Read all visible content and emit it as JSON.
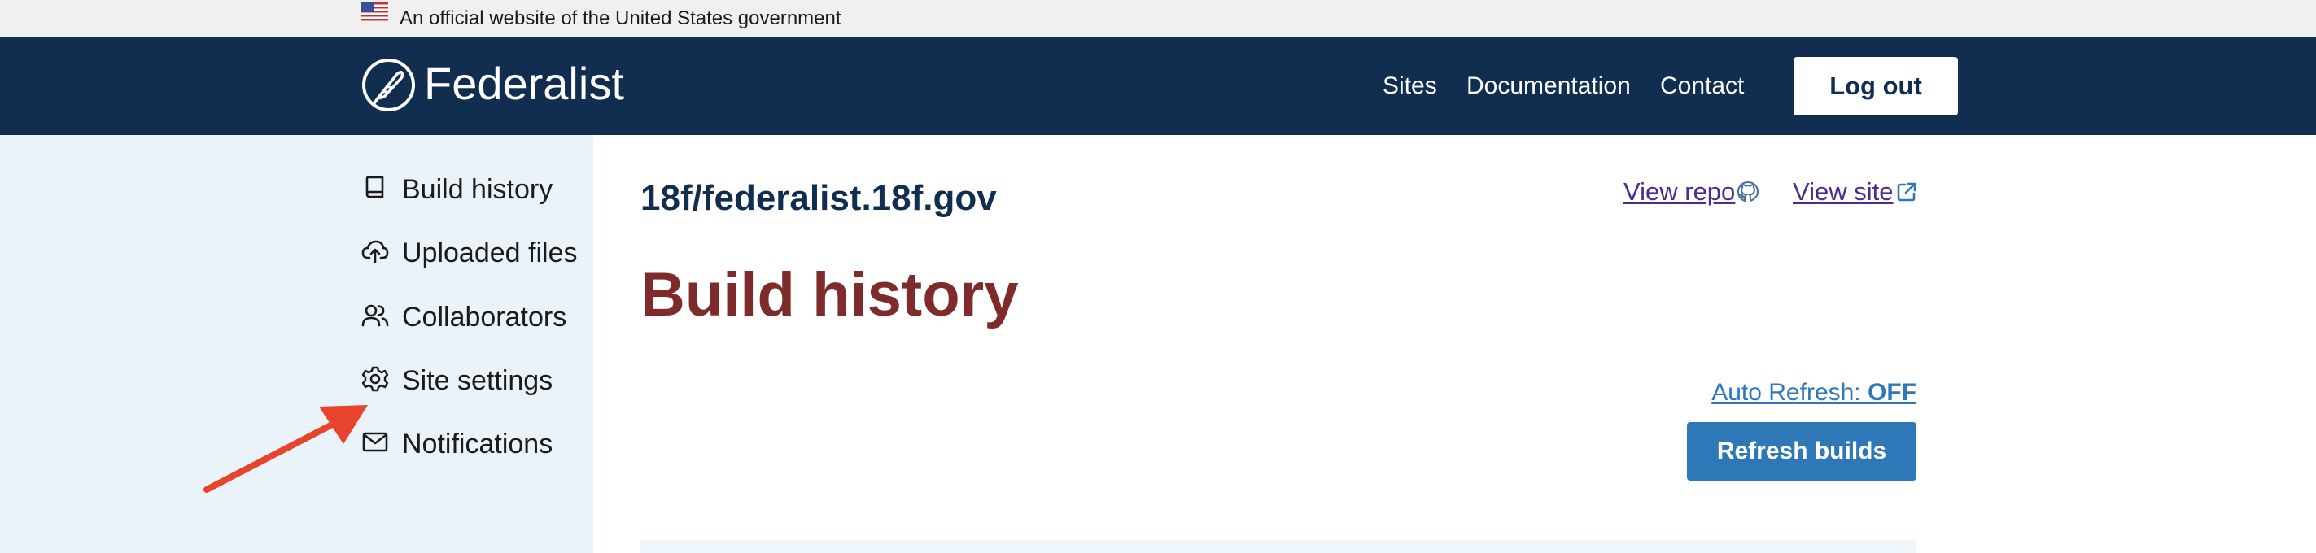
{
  "gov_banner": {
    "text": "An official website of the United States government"
  },
  "header": {
    "app_name": "Federalist",
    "nav": [
      {
        "label": "Sites"
      },
      {
        "label": "Documentation"
      },
      {
        "label": "Contact"
      }
    ],
    "logout_label": "Log out"
  },
  "sidebar": {
    "items": [
      {
        "label": "Build history",
        "icon": "book-icon"
      },
      {
        "label": "Uploaded files",
        "icon": "cloud-upload-icon"
      },
      {
        "label": "Collaborators",
        "icon": "users-icon"
      },
      {
        "label": "Site settings",
        "icon": "gear-icon"
      },
      {
        "label": "Notifications",
        "icon": "envelope-icon"
      }
    ]
  },
  "main": {
    "site_name": "18f/federalist.18f.gov",
    "view_repo_label": "View repo",
    "view_site_label": "View site",
    "page_title": "Build history",
    "auto_refresh_label": "Auto Refresh:",
    "auto_refresh_state": "OFF",
    "refresh_button_label": "Refresh builds"
  },
  "colors": {
    "header_bg": "#112e51",
    "sidebar_bg": "#ebf3fa",
    "title_color": "#7f2b2b",
    "primary_button": "#2f78b7",
    "annotation_arrow": "#e8432c"
  }
}
